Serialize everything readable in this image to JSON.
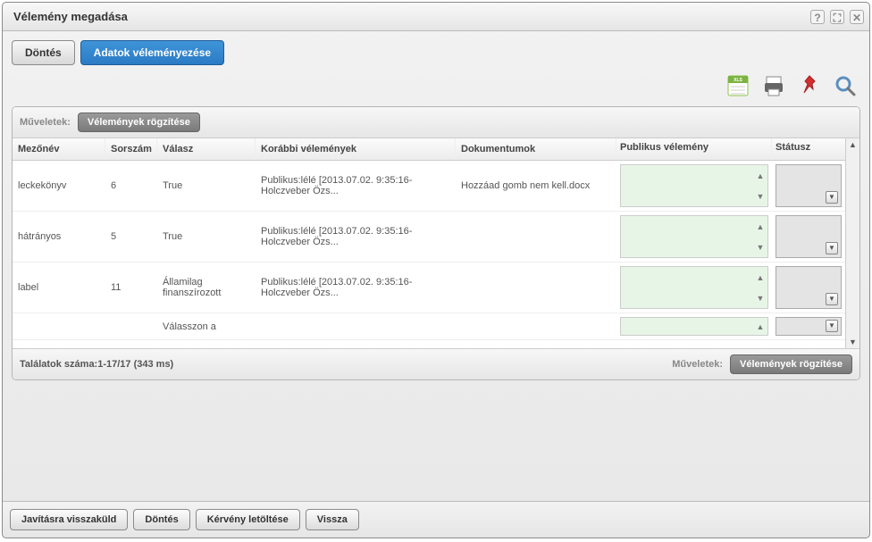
{
  "window": {
    "title": "Vélemény megadása"
  },
  "tabs": {
    "dontes": "Döntés",
    "adatok": "Adatok véleményezése"
  },
  "panel": {
    "muveletek_label": "Műveletek:",
    "rogzites_label": "Vélemények rögzítése"
  },
  "columns": {
    "mezonev": "Mezőnév",
    "sorszam": "Sorszám",
    "valasz": "Válasz",
    "korabbi": "Korábbi vélemények",
    "dokumentumok": "Dokumentumok",
    "publikus": "Publikus vélemény",
    "statusz": "Státusz"
  },
  "rows": [
    {
      "mezonev": "leckekönyv",
      "sorszam": "6",
      "valasz": "True",
      "korabbi": "Publikus:lélé [2013.07.02. 9:35:16-Holczveber Özs...",
      "dok": "Hozzáad gomb nem kell.docx"
    },
    {
      "mezonev": "hátrányos",
      "sorszam": "5",
      "valasz": "True",
      "korabbi": "Publikus:lélé [2013.07.02. 9:35:16-Holczveber Özs...",
      "dok": ""
    },
    {
      "mezonev": "label",
      "sorszam": "11",
      "valasz": "Államilag finanszírozott",
      "korabbi": "Publikus:lélé [2013.07.02. 9:35:16-Holczveber Özs...",
      "dok": ""
    },
    {
      "mezonev": "",
      "sorszam": "",
      "valasz": "Válasszon a",
      "korabbi": "",
      "dok": ""
    }
  ],
  "footer": {
    "talalatok": "Találatok száma:1-17/17 (343 ms)",
    "muveletek_label": "Műveletek:",
    "rogzites_label": "Vélemények rögzítése"
  },
  "buttons": {
    "javitasra": "Javításra visszaküld",
    "dontes": "Döntés",
    "kerveny": "Kérvény letöltése",
    "vissza": "Vissza"
  }
}
